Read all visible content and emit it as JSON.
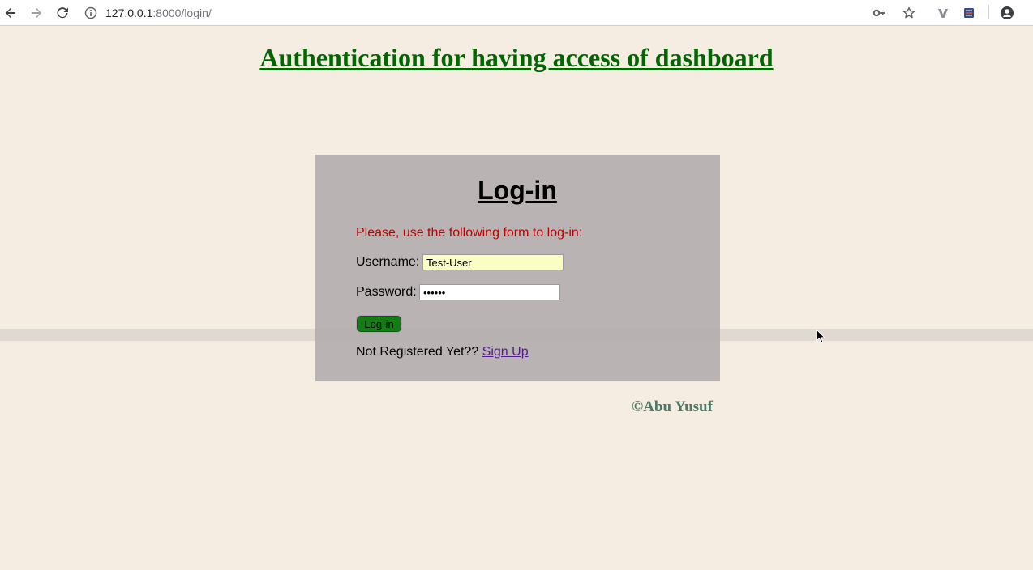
{
  "browser": {
    "url_host": "127.0.0.1",
    "url_path": ":8000/login/",
    "icons": [
      "back-arrow-icon",
      "forward-arrow-icon",
      "reload-icon",
      "info-icon",
      "key-icon",
      "star-icon",
      "extension-v-icon",
      "extension-list-icon",
      "account-icon"
    ]
  },
  "page": {
    "title": "Authentication for having access of dashboard",
    "background": "#f5ece2",
    "title_color": "#006600"
  },
  "login": {
    "heading": "Log-in",
    "instruction": "Please, use the following form to log-in:",
    "instruction_color": "#c00000",
    "username_label": "Username:",
    "username_value": "Test-User",
    "password_label": "Password:",
    "password_value": "••••••",
    "button_label": "Log-in",
    "register_prompt": "Not Registered Yet??",
    "signup_label": "Sign Up"
  },
  "footer": {
    "copyright": "©Abu Yusuf"
  }
}
